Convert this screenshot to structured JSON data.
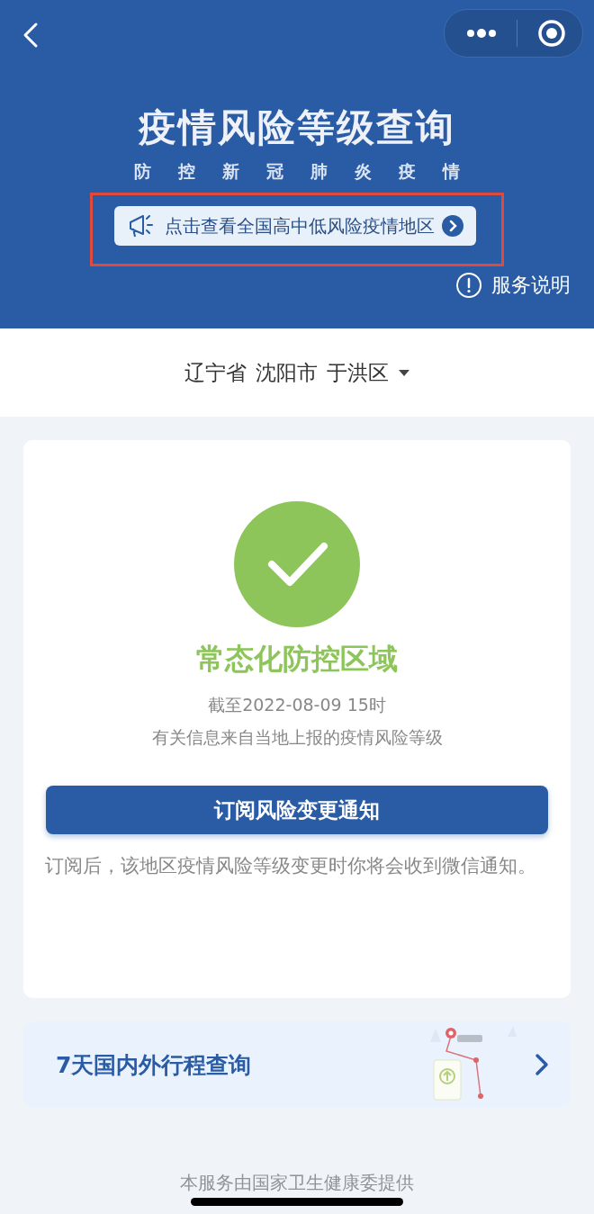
{
  "header": {
    "title": "疫情风险等级查询",
    "subtitle": "防控新冠肺炎疫情",
    "notice": "点击查看全国高中低风险疫情地区",
    "notice_highlighted": true,
    "help": "服务说明"
  },
  "location": {
    "province": "辽宁省",
    "city": "沈阳市",
    "district": "于洪区"
  },
  "result": {
    "status": "常态化防控区域",
    "color": "#8dc55a",
    "updated": "截至2022-08-09 15时",
    "source": "有关信息来自当地上报的疫情风险等级",
    "subscribe_button": "订阅风险变更通知",
    "subscribe_note": "订阅后，该地区疫情风险等级变更时你将会收到微信通知。"
  },
  "trip_card": {
    "label": "7天国内外行程查询"
  },
  "footer": "本服务由国家卫生健康委提供"
}
